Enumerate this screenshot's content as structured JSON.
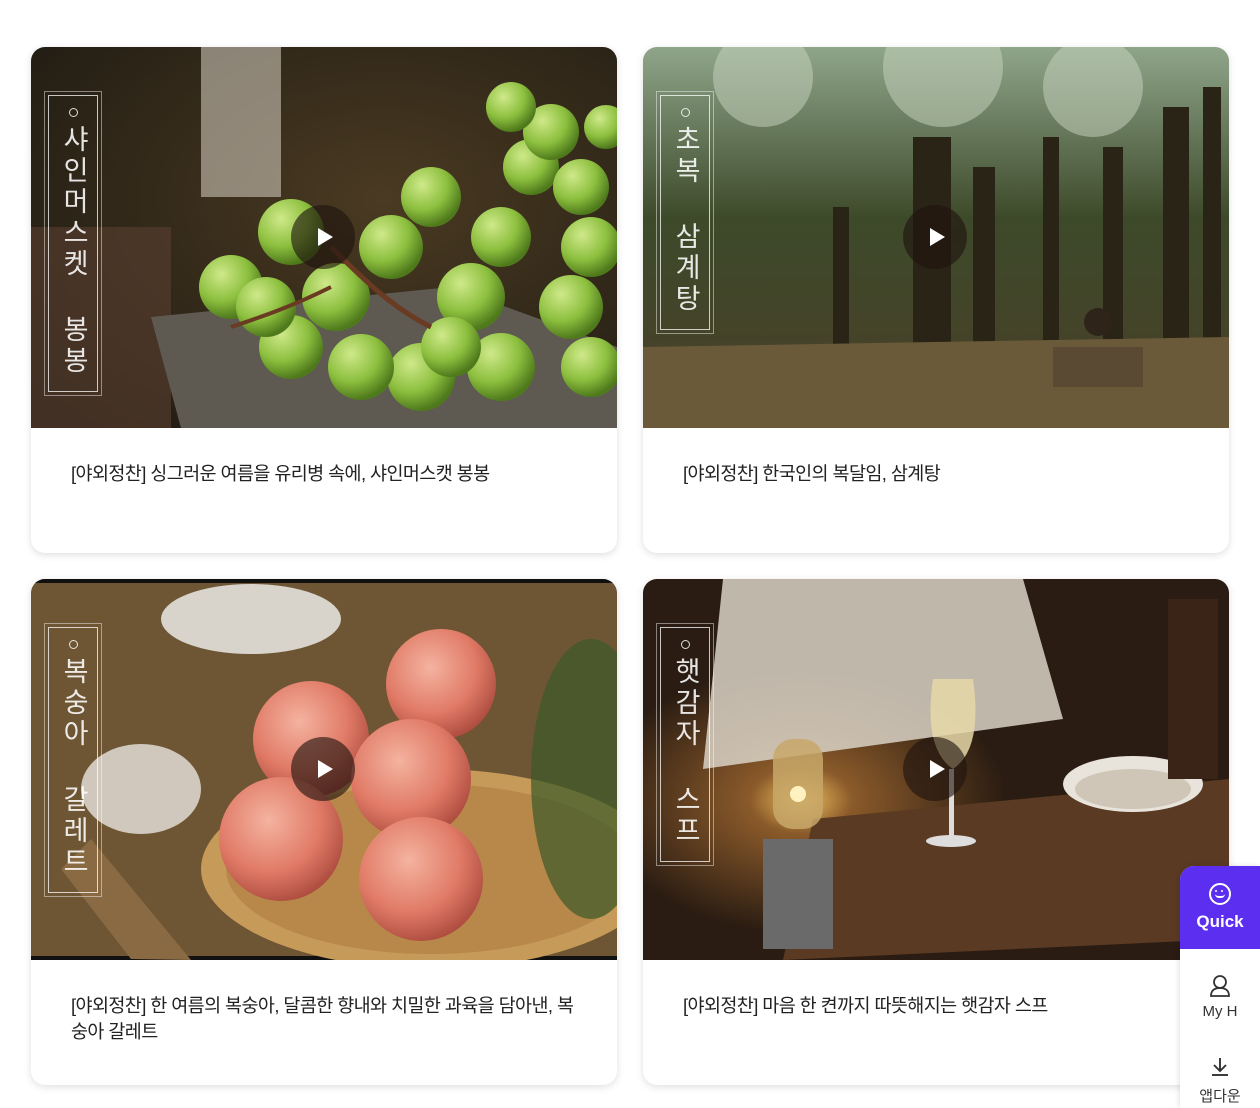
{
  "cards": [
    {
      "vertical_title": "샤인머스켓 봉봉",
      "caption": "[야외정찬] 싱그러운 여름을 유리병 속에, 샤인머스캣 봉봉"
    },
    {
      "vertical_title": "초복 삼계탕",
      "caption": "[야외정찬] 한국인의 복달임, 삼계탕"
    },
    {
      "vertical_title": "복숭아 갈레트",
      "caption": "[야외정찬] 한 여름의 복숭아, 달콤한 향내와 치밀한 과육을 담아낸, 복숭아 갈레트"
    },
    {
      "vertical_title": "햇감자 스프",
      "caption": "[야외정찬] 마음 한 켠까지 따뜻해지는 햇감자 스프"
    }
  ],
  "quick_menu": {
    "quick_label": "Quick",
    "my_label": "My H",
    "app_label": "앱다운"
  },
  "colors": {
    "accent": "#5b2ef0"
  }
}
